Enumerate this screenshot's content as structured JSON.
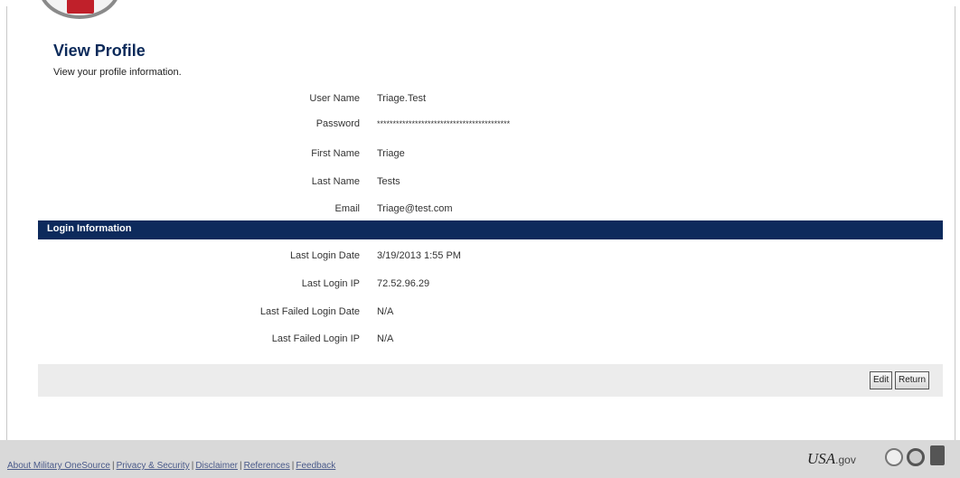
{
  "header": {
    "title": "View Profile",
    "subtitle": "View your profile information."
  },
  "profile": [
    {
      "label": "User Name",
      "value": "Triage.Test"
    },
    {
      "label": "Password",
      "value": "******************************************"
    },
    {
      "label": "First Name",
      "value": "Triage"
    },
    {
      "label": "Last Name",
      "value": "Tests"
    },
    {
      "label": "Email",
      "value": "Triage@test.com"
    }
  ],
  "login_section": {
    "title": "Login Information",
    "fields": [
      {
        "label": "Last Login Date",
        "value": "3/19/2013 1:55 PM"
      },
      {
        "label": "Last Login IP",
        "value": "72.52.96.29"
      },
      {
        "label": "Last Failed Login Date",
        "value": "N/A"
      },
      {
        "label": "Last Failed Login IP",
        "value": "N/A"
      }
    ]
  },
  "buttons": {
    "edit": "Edit",
    "return": "Return"
  },
  "footer": {
    "links": [
      "About Military OneSource",
      "Privacy & Security",
      "Disclaimer",
      "References",
      "Feedback"
    ],
    "usa_gov": "USA",
    "usa_gov_suffix": ".gov"
  },
  "colors": {
    "section_bar": "#0d2a5c",
    "title": "#0b2a5a"
  }
}
